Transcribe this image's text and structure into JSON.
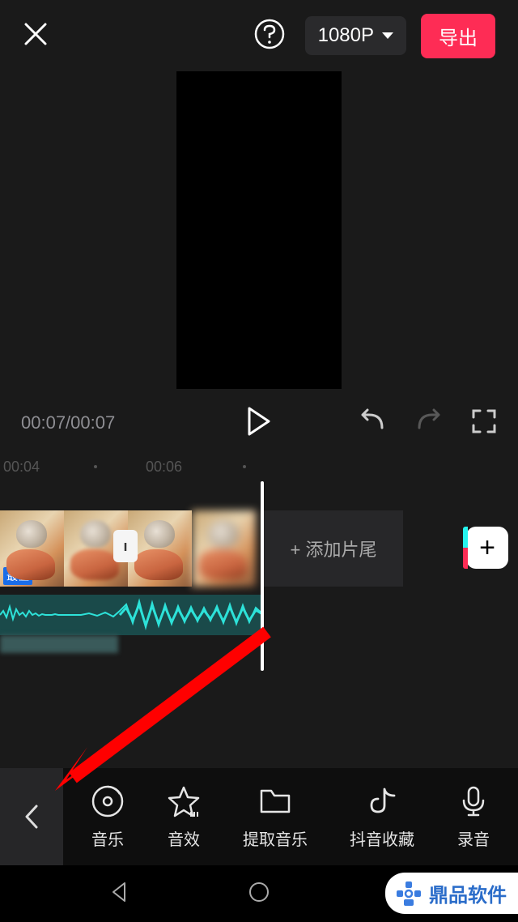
{
  "topbar": {
    "resolution": "1080P",
    "export_label": "导出"
  },
  "playback": {
    "time_display": "00:07/00:07"
  },
  "ruler": {
    "labels": [
      "00:04",
      "00:06"
    ]
  },
  "timeline": {
    "clip_caption": "最佳",
    "add_ending_label": "+  添加片尾",
    "add_clip_label": "+"
  },
  "toolbar": {
    "items": [
      {
        "label": "音乐",
        "icon": "music-disc-icon"
      },
      {
        "label": "音效",
        "icon": "star-effect-icon"
      },
      {
        "label": "提取音乐",
        "icon": "folder-icon"
      },
      {
        "label": "抖音收藏",
        "icon": "douyin-icon"
      },
      {
        "label": "录音",
        "icon": "microphone-icon"
      }
    ]
  },
  "watermark": {
    "text": "鼎品软件"
  }
}
